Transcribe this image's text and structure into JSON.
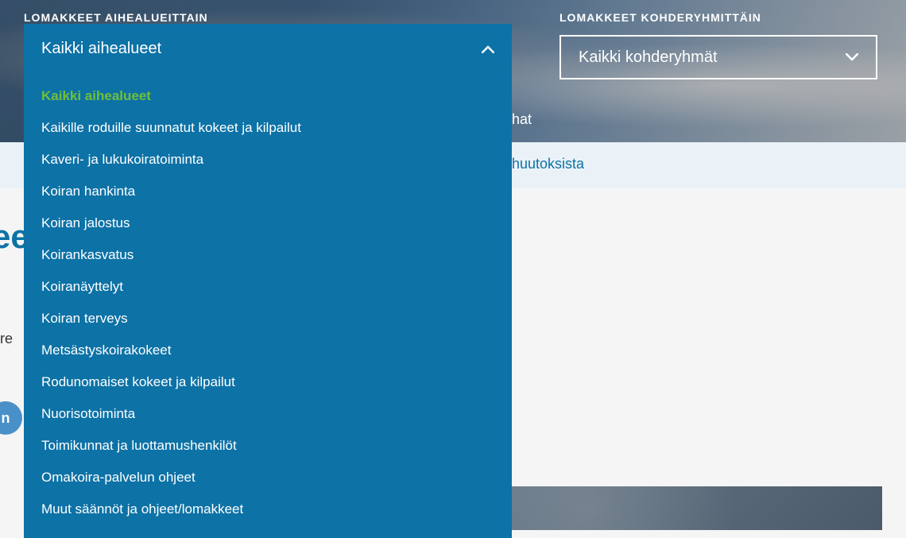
{
  "filters": {
    "left": {
      "label": "LOMAKKEET AIHEALUEITTAIN",
      "selected": "Kaikki aihealueet"
    },
    "right": {
      "label": "LOMAKKEET KOHDERYHMITTÄIN",
      "selected": "Kaikki kohderyhmät"
    }
  },
  "dropdown_items": [
    {
      "label": "Kaikki aihealueet",
      "active": true
    },
    {
      "label": "Kaikille roduille suunnatut kokeet ja kilpailut",
      "active": false
    },
    {
      "label": "Kaveri- ja lukukoiratoiminta",
      "active": false
    },
    {
      "label": "Koiran hankinta",
      "active": false
    },
    {
      "label": "Koiran jalostus",
      "active": false
    },
    {
      "label": "Koirankasvatus",
      "active": false
    },
    {
      "label": "Koiranäyttelyt",
      "active": false
    },
    {
      "label": "Koiran terveys",
      "active": false
    },
    {
      "label": "Metsästyskoirakokeet",
      "active": false
    },
    {
      "label": "Rodunomaiset kokeet ja kilpailut",
      "active": false
    },
    {
      "label": "Nuorisotoiminta",
      "active": false
    },
    {
      "label": "Toimikunnat ja luottamushenkilöt",
      "active": false
    },
    {
      "label": "Omakoira-palvelun ohjeet",
      "active": false
    },
    {
      "label": "Muut säännöt ja ohjeet/lomakkeet",
      "active": false
    }
  ],
  "partial": {
    "hat": "hat",
    "link_fragment": "huutoksista",
    "heading_fragment": "ee",
    "body_fragment": "ere"
  },
  "social": {
    "label": "n"
  }
}
